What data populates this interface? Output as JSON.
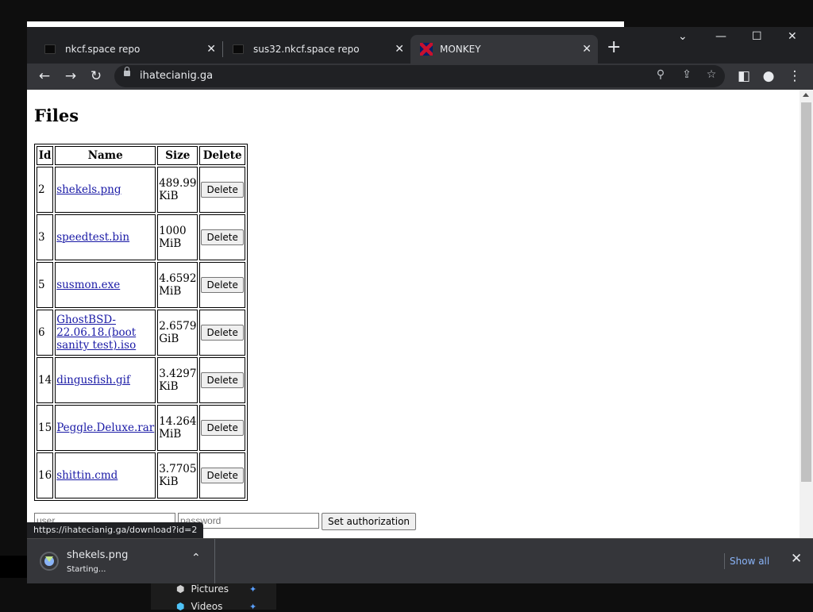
{
  "tabs": [
    {
      "title": "nkcf.space repo"
    },
    {
      "title": "sus32.nkcf.space repo"
    },
    {
      "title": "MONKEY"
    }
  ],
  "toolbar": {
    "url": "ihatecianig.ga"
  },
  "page": {
    "heading": "Files",
    "columns": [
      "Id",
      "Name",
      "Size",
      "Delete"
    ],
    "rows": [
      {
        "id": "2",
        "name": "shekels.png",
        "size": "489.99 KiB",
        "action": "Delete"
      },
      {
        "id": "3",
        "name": "speedtest.bin",
        "size": "1000 MiB",
        "action": "Delete"
      },
      {
        "id": "5",
        "name": "susmon.exe",
        "size": "4.6592 MiB",
        "action": "Delete"
      },
      {
        "id": "6",
        "name": "GhostBSD-22.06.18.(boot sanity test).iso",
        "size": "2.6579 GiB",
        "action": "Delete"
      },
      {
        "id": "14",
        "name": "dingusfish.gif",
        "size": "3.4297 KiB",
        "action": "Delete"
      },
      {
        "id": "15",
        "name": "Peggle.Deluxe.rar",
        "size": "14.264 MiB",
        "action": "Delete"
      },
      {
        "id": "16",
        "name": "shittin.cmd",
        "size": "3.7705 KiB",
        "action": "Delete"
      }
    ],
    "auth": {
      "user_placeholder": "user",
      "password_placeholder": "password",
      "button_label": "Set authorization"
    }
  },
  "status_url": "https://ihatecianig.ga/download?id=2",
  "download": {
    "filename": "shekels.png",
    "status": "Starting...",
    "show_all_label": "Show all"
  },
  "explorer": {
    "items": [
      "Pictures",
      "Videos"
    ]
  }
}
